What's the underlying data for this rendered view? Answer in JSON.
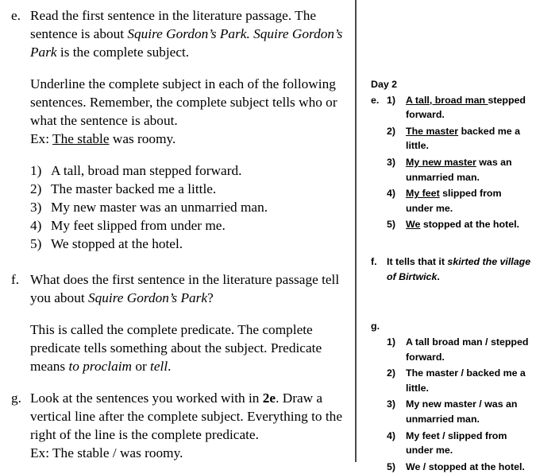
{
  "left_column": {
    "item_e": {
      "label": "e.",
      "para1_part1": "Read the first sentence in the literature passage.  The sentence is about ",
      "para1_italic1": "Squire Gordon’s Park.",
      "para1_part2": "  ",
      "para1_italic2": "Squire Gordon’s Park",
      "para1_part3": "  is the complete subject.",
      "para2": "Underline the complete subject in each of the following sentences.  Remember, the complete subject tells who or what the sentence is about.",
      "example_prefix": "Ex:  ",
      "example_underlined": "The stable",
      "example_rest": " was roomy.",
      "sentences": [
        {
          "num": "1)",
          "text": "A tall, broad man stepped forward."
        },
        {
          "num": "2)",
          "text": "The master backed me a little."
        },
        {
          "num": "3)",
          "text": "My new master was an unmarried man."
        },
        {
          "num": "4)",
          "text": "My feet slipped from under me."
        },
        {
          "num": "5)",
          "text": "We stopped at the hotel."
        }
      ]
    },
    "item_f": {
      "label": "f.",
      "question_part1": "What does the first sentence in the literature passage tell you about ",
      "question_italic": "Squire Gordon’s Park",
      "question_part2": "?",
      "para_part1": "This is called the complete predicate. The complete predicate tells something about the subject.  Predicate means ",
      "para_italic1": "to proclaim",
      "para_part2": " or ",
      "para_italic2": "tell",
      "para_part3": "."
    },
    "item_g": {
      "label": "g.",
      "para_part1": "Look at the sentences you worked with in ",
      "para_bold": "2e",
      "para_part2": ".  Draw a vertical line after the complete subject.  Everything to the right of the line is the complete predicate.",
      "example": "Ex:  The stable / was roomy."
    }
  },
  "right_column": {
    "day_heading": "Day 2",
    "answer_e": {
      "label": "e.",
      "items": [
        {
          "num": "1)",
          "subject": "A tall, broad man ",
          "predicate": "stepped forward."
        },
        {
          "num": "2)",
          "subject": "The master",
          "predicate": " backed me a little."
        },
        {
          "num": "3)",
          "subject": "My new master",
          "predicate": " was an unmarried man."
        },
        {
          "num": "4)",
          "subject": "My feet",
          "predicate": " slipped from under me."
        },
        {
          "num": "5)",
          "subject": "We",
          "predicate": " stopped at the hotel."
        }
      ]
    },
    "answer_f": {
      "label": "f.",
      "text_plain": "It tells that it ",
      "text_italic": "skirted the village of Birtwick",
      "text_end": "."
    },
    "answer_g": {
      "label": "g.",
      "items": [
        {
          "num": "1)",
          "text": "A tall broad man / stepped forward."
        },
        {
          "num": "2)",
          "text": "The master / backed me a little."
        },
        {
          "num": "3)",
          "text": "My new master / was an unmarried man."
        },
        {
          "num": "4)",
          "text": "My feet / slipped from under me."
        },
        {
          "num": "5)",
          "text": "We / stopped at the hotel."
        }
      ]
    }
  }
}
